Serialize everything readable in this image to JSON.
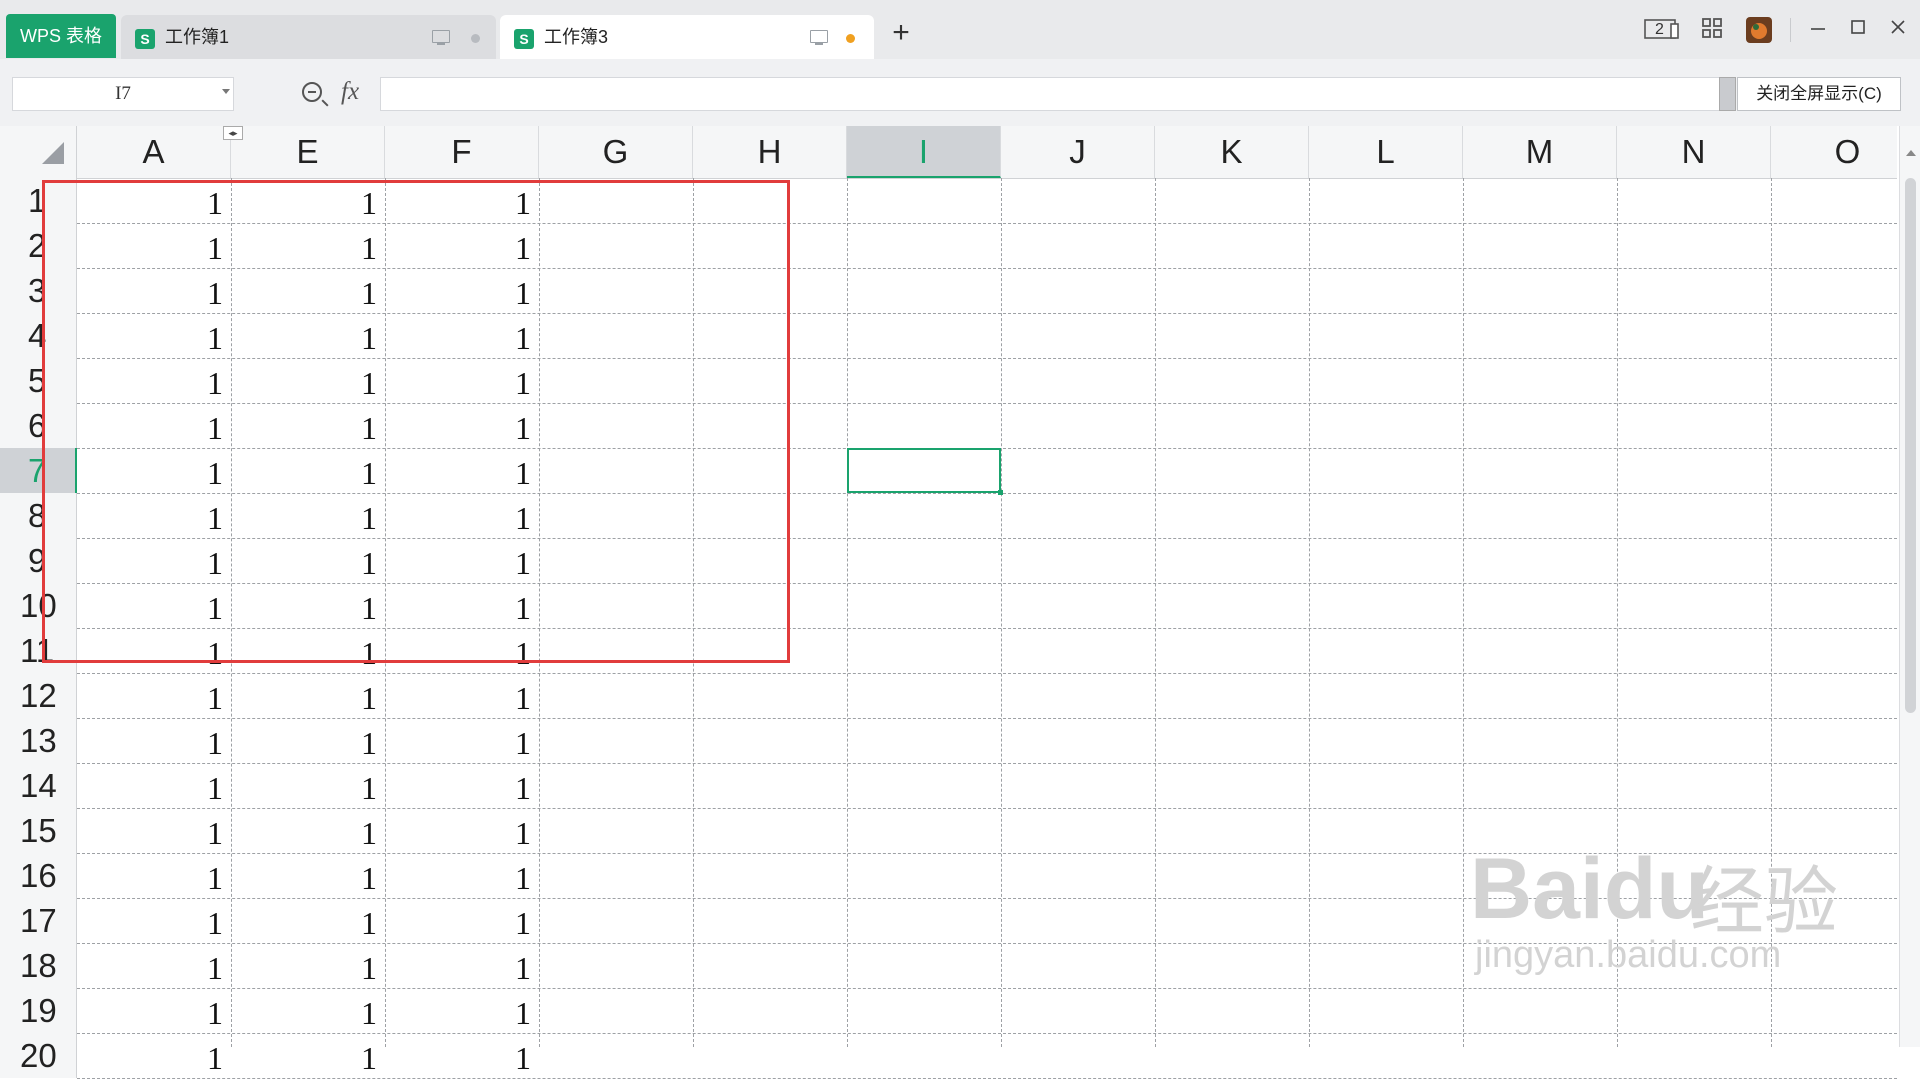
{
  "app": {
    "name": "WPS 表格"
  },
  "tabs": [
    {
      "label": "工作簿1",
      "icon": "S",
      "modified": false
    },
    {
      "label": "工作簿3",
      "icon": "S",
      "modified": true
    }
  ],
  "window_controls": {
    "page_badge": "2"
  },
  "formula_bar": {
    "name_box": "I7",
    "fx": "fx",
    "formula_value": "",
    "fullscreen_label": "关闭全屏显示(C)"
  },
  "sheet": {
    "columns": [
      "A",
      "E",
      "F",
      "G",
      "H",
      "I",
      "J",
      "K",
      "L",
      "M",
      "N",
      "O"
    ],
    "selected_column": "I",
    "rows": [
      "1",
      "2",
      "3",
      "4",
      "5",
      "6",
      "7",
      "8",
      "9",
      "10",
      "11",
      "12",
      "13",
      "14",
      "15",
      "16",
      "17",
      "18",
      "19",
      "20"
    ],
    "selected_row": "7",
    "active_cell": "I7",
    "values": {
      "A": [
        "1",
        "1",
        "1",
        "1",
        "1",
        "1",
        "1",
        "1",
        "1",
        "1",
        "1",
        "1",
        "1",
        "1",
        "1",
        "1",
        "1",
        "1",
        "1",
        "1"
      ],
      "E": [
        "1",
        "1",
        "1",
        "1",
        "1",
        "1",
        "1",
        "1",
        "1",
        "1",
        "1",
        "1",
        "1",
        "1",
        "1",
        "1",
        "1",
        "1",
        "1",
        "1"
      ],
      "F": [
        "1",
        "1",
        "1",
        "1",
        "1",
        "1",
        "1",
        "1",
        "1",
        "1",
        "1",
        "1",
        "1",
        "1",
        "1",
        "1",
        "1",
        "1",
        "1",
        "1"
      ]
    }
  },
  "watermark": {
    "brand": "Baidu",
    "brand_cn": "经验",
    "url": "jingyan.baidu.com"
  }
}
